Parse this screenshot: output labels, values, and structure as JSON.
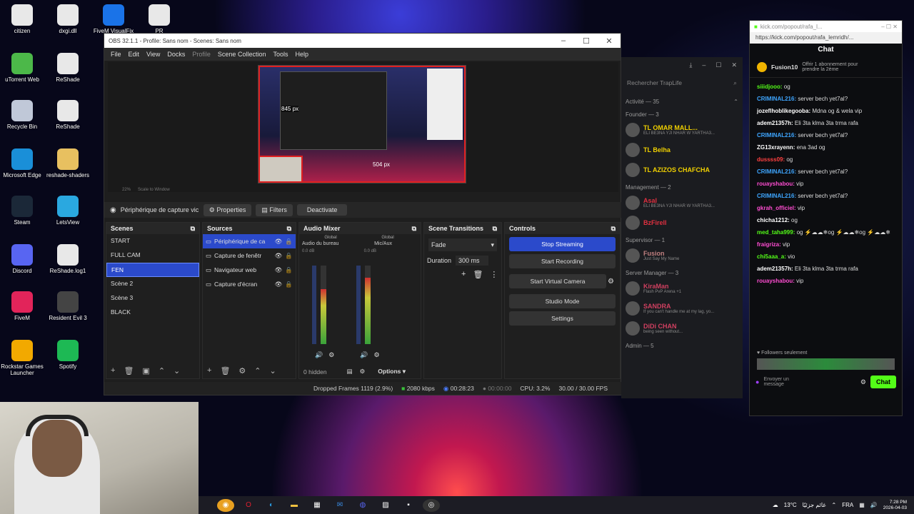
{
  "desktop_icons": [
    {
      "label": "citizen",
      "icon": "folder-icon",
      "color": "#e8e8e8",
      "x": 0
    },
    {
      "label": "dxgi.dll",
      "icon": "file-icon",
      "color": "#e8e8e8"
    },
    {
      "label": "FiveM VisualFix",
      "icon": "edge-icon",
      "color": "#1a73e8"
    },
    {
      "label": "PR",
      "icon": "file-icon",
      "color": "#e8e8e8"
    },
    {
      "label": "uTorrent Web",
      "icon": "utorrent-icon",
      "color": "#4cb849"
    },
    {
      "label": "ReShade",
      "icon": "file-icon",
      "color": "#e8e8e8"
    },
    {
      "label": "Recycle Bin",
      "icon": "recycle-bin-icon",
      "color": "#c0c8d8"
    },
    {
      "label": "ReShade",
      "icon": "file-icon",
      "color": "#e8e8e8"
    },
    {
      "label": "Microsoft Edge",
      "icon": "edge-icon",
      "color": "#1a8fd8"
    },
    {
      "label": "reshade-shaders",
      "icon": "folder-icon",
      "color": "#e8c060"
    },
    {
      "label": "Steam",
      "icon": "steam-icon",
      "color": "#1b2838"
    },
    {
      "label": "LetsView",
      "icon": "letsview-icon",
      "color": "#2aa8e0"
    },
    {
      "label": "Discord",
      "icon": "discord-icon",
      "color": "#5865f2"
    },
    {
      "label": "ReShade.log1",
      "icon": "file-icon",
      "color": "#e8e8e8"
    },
    {
      "label": "FiveM",
      "icon": "fivem-icon",
      "color": "#e2245a"
    },
    {
      "label": "Resident Evil 3",
      "icon": "game-icon",
      "color": "#444"
    },
    {
      "label": "Rockstar Games Launcher",
      "icon": "rockstar-icon",
      "color": "#f2a900"
    },
    {
      "label": "Spotify",
      "icon": "spotify-icon",
      "color": "#1db954"
    }
  ],
  "obs": {
    "title": "OBS 32.1.1 - Profile: Sans nom - Scenes: Sans nom",
    "menu": [
      "File",
      "Edit",
      "View",
      "Docks",
      "Profile",
      "Scene Collection",
      "Tools",
      "Help"
    ],
    "preview_labels": {
      "width": "845 px",
      "height": "504 px"
    },
    "zoom_text": "22%",
    "scale_text": "Scale to Window",
    "source_bar": {
      "source_name": "Périphérique de capture vic",
      "properties": "Properties",
      "filters": "Filters",
      "deactivate": "Deactivate"
    },
    "scenes": {
      "title": "Scenes",
      "items": [
        "START",
        "FULL CAM",
        "FEN",
        "Scène 2",
        "Scène 3",
        "BLACK"
      ],
      "selected": 2
    },
    "sources": {
      "title": "Sources",
      "items": [
        "Périphérique de ca",
        "Capture de fenêtr",
        "Navigateur web",
        "Capture d'écran"
      ],
      "selected": 0
    },
    "audio": {
      "title": "Audio Mixer",
      "ch1": "Audio du bureau",
      "ch2": "Mic/Aux",
      "global": "Global",
      "db1": "0.0 dB",
      "db2": "0.0 dB",
      "hidden": "0 hidden",
      "options": "Options",
      "levels": [
        0.7,
        0.85
      ]
    },
    "transitions": {
      "title": "Scene Transitions",
      "type": "Fade",
      "duration_label": "Duration",
      "duration": "300 ms"
    },
    "controls": {
      "title": "Controls",
      "stop_streaming": "Stop Streaming",
      "start_recording": "Start Recording",
      "virtual_camera": "Start Virtual Camera",
      "studio_mode": "Studio Mode",
      "settings": "Settings"
    },
    "status": {
      "dropped": "Dropped Frames 1119 (2.9%)",
      "bitrate": "2080 kbps",
      "stream_time": "00:28:23",
      "rec_time": "00:00:00",
      "cpu": "CPU: 3.2%",
      "fps": "30.00 / 30.00 FPS"
    }
  },
  "discord": {
    "search": "Rechercher TrapLife",
    "activity": "Activité — 35",
    "sections": [
      {
        "title": "Founder — 3",
        "members": [
          {
            "name": "TL OMAR MALL...",
            "status": "ELI BE3NA YJI NHAR W YARTHA3...",
            "color": "#f0d000"
          },
          {
            "name": "TL Belha",
            "status": "",
            "color": "#f0d000"
          },
          {
            "name": "TL AZIZOS CHAFCHA",
            "status": "",
            "color": "#f0d000"
          }
        ]
      },
      {
        "title": "Management — 2",
        "members": [
          {
            "name": "Asal",
            "status": "ELI BE3NA YJI NHAR W YARTHA3...",
            "color": "#e03040"
          },
          {
            "name": "BzFirell",
            "status": "",
            "color": "#e03040"
          }
        ]
      },
      {
        "title": "Supervisor — 1",
        "members": [
          {
            "name": "Fusion",
            "status": "Just Say My Name",
            "color": "#c08080"
          }
        ]
      },
      {
        "title": "Server Manager — 3",
        "members": [
          {
            "name": "KiraMan",
            "status": "Flash PvP Arena +1",
            "color": "#d04060"
          },
          {
            "name": "SANDRA",
            "status": "If you can't handle me at my lag, yo...",
            "color": "#d04060"
          },
          {
            "name": "DiDi CHAN",
            "status": "being seen without...",
            "color": "#d04060"
          }
        ]
      },
      {
        "title": "Admin — 5",
        "members": []
      }
    ]
  },
  "kick": {
    "tab_title": "kick.com/popout/rafa_l...",
    "url": "https://kick.com/popout/rafa_lemridh/...",
    "chat_title": "Chat",
    "pinned_user": "Fusion10",
    "pinned_text": "Offrir 1 abonnement pour prendre la 2ème",
    "messages": [
      {
        "user": "siiidjooo",
        "text": "og",
        "color": "#53fc18"
      },
      {
        "user": "CRIMINAL216",
        "text": "server bech yet7al?",
        "color": "#3ea6ff"
      },
      {
        "user": "jozeflhoblikegooba",
        "text": "Mdna og & wela vip",
        "color": "#ffffff"
      },
      {
        "user": "adem21357h",
        "text": "Eli 3ta klma 3ta trma rafa",
        "color": "#ffffff"
      },
      {
        "user": "CRIMINAL216",
        "text": "server bech yet7al?",
        "color": "#3ea6ff"
      },
      {
        "user": "ZG13xrayenn",
        "text": "ena 3ad og",
        "color": "#ffffff"
      },
      {
        "user": "dussss09",
        "text": "og",
        "color": "#ff4040"
      },
      {
        "user": "CRIMINAL216",
        "text": "server bech yet7al?",
        "color": "#3ea6ff"
      },
      {
        "user": "rouayshabou",
        "text": "vip",
        "color": "#ff4dd2"
      },
      {
        "user": "CRIMINAL216",
        "text": "server bech yet7al?",
        "color": "#3ea6ff"
      },
      {
        "user": "gkrah_officiel",
        "text": "vip",
        "color": "#ff4dd2"
      },
      {
        "user": "chicha1212",
        "text": "og",
        "color": "#ffffff"
      },
      {
        "user": "med_taha999",
        "text": "og ⚡☁☁❄og ⚡☁☁❄og ⚡☁☁❄",
        "color": "#53fc18"
      },
      {
        "user": "fraigriza",
        "text": "vip",
        "color": "#ff4dd2"
      },
      {
        "user": "chi5aaa_a",
        "text": "vio",
        "color": "#53fc18"
      },
      {
        "user": "adem21357h",
        "text": "Eli 3ta klma 3ta trma rafa",
        "color": "#ffffff"
      },
      {
        "user": "rouayshabou",
        "text": "vip",
        "color": "#ff4dd2"
      }
    ],
    "followers_only": "Followers seulement",
    "input_placeholder": "Envoyer un message",
    "chat_button": "Chat"
  },
  "taskbar": {
    "weather": "13°C",
    "weather_text": "غائم جزئيًا",
    "lang": "FRA",
    "time": "7:28 PM",
    "date": "2026-04-03"
  }
}
